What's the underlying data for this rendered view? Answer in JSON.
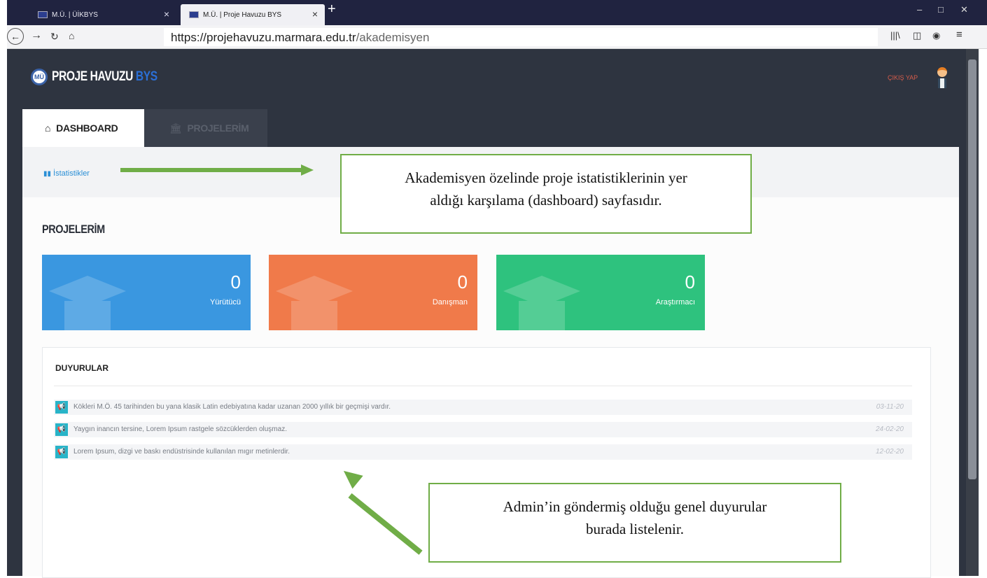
{
  "browser": {
    "tabs": [
      {
        "label": "M.Ü. | ÜİKBYS"
      },
      {
        "label": "M.Ü. | Proje Havuzu BYS"
      }
    ],
    "new_tab": "+",
    "url_main": "https://projehavuzu.marmara.edu.tr",
    "url_path": "/akademisyen",
    "window_controls": {
      "minimize": "–",
      "maximize": "□",
      "close": "✕"
    }
  },
  "header": {
    "logo_main": "PROJE HAVUZU",
    "logo_accent": "BYS",
    "logout": "ÇIKIŞ YAP"
  },
  "nav_tabs": [
    {
      "label": "DASHBOARD",
      "icon": "home-icon",
      "active": true
    },
    {
      "label": "PROJELERİM",
      "icon": "institution-icon",
      "active": false
    }
  ],
  "subnav": {
    "link": "İstatistikler",
    "icon": "bar-chart-icon"
  },
  "section_title": "PROJELERİM",
  "stat_cards": [
    {
      "count": "0",
      "label": "Yürütücü",
      "color": "#3a97e0"
    },
    {
      "count": "0",
      "label": "Danışman",
      "color": "#f07a4a"
    },
    {
      "count": "0",
      "label": "Araştırmacı",
      "color": "#2ec27e"
    }
  ],
  "announcements": {
    "title": "DUYURULAR",
    "items": [
      {
        "text": "Kökleri M.Ö. 45 tarihinden bu yana klasik Latin edebiyatına kadar uzanan 2000 yıllık bir geçmişi vardır.",
        "date": "03-11-20"
      },
      {
        "text": "Yaygın inancın tersine, Lorem Ipsum rastgele sözcüklerden oluşmaz.",
        "date": "24-02-20"
      },
      {
        "text": "Lorem Ipsum, dizgi ve baskı endüstrisinde kullanılan mıgır metinlerdir.",
        "date": "12-02-20"
      }
    ]
  },
  "callouts": {
    "dashboard_line1": "Akademisyen özelinde proje istatistiklerinin yer",
    "dashboard_line2": "aldığı karşılama (dashboard) sayfasıdır.",
    "announcement_line1": "Admin’in göndermiş olduğu genel duyurular",
    "announcement_line2": "burada listelenir."
  },
  "colors": {
    "accent": "#2b6fd6",
    "callout_border": "#70ad47",
    "dark_bg": "#2e3440"
  }
}
